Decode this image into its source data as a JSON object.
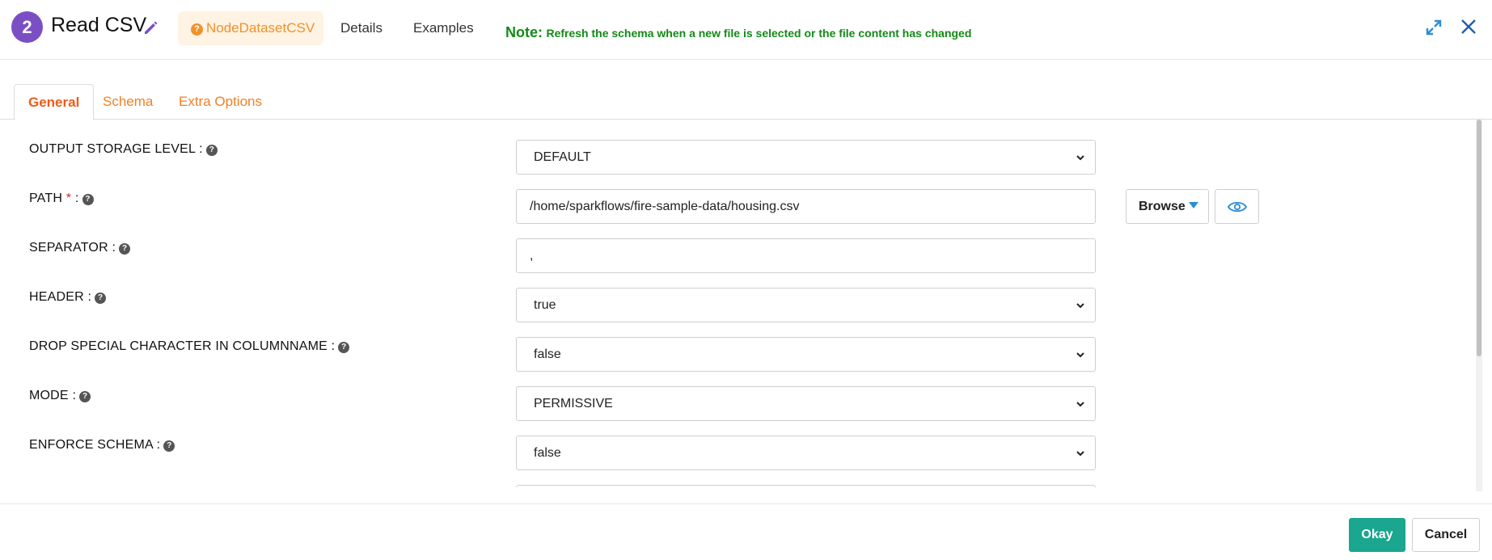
{
  "header": {
    "step_number": "2",
    "title": "Read CSV",
    "node_type": "NodeDatasetCSV",
    "details_link": "Details",
    "examples_link": "Examples",
    "note_label": "Note:",
    "note_text": "Refresh the schema when a new file is selected or the file content has changed"
  },
  "tabs": [
    {
      "label": "General",
      "active": true
    },
    {
      "label": "Schema",
      "active": false
    },
    {
      "label": "Extra Options",
      "active": false
    }
  ],
  "form": {
    "output_storage_level": {
      "label": "OUTPUT STORAGE LEVEL :",
      "value": "DEFAULT"
    },
    "path": {
      "label": "PATH",
      "required_mark": "*",
      "suffix": ":",
      "value": "/home/sparkflows/fire-sample-data/housing.csv"
    },
    "separator": {
      "label": "SEPARATOR :",
      "value": ","
    },
    "header": {
      "label": "HEADER :",
      "value": "true"
    },
    "drop_special": {
      "label": "DROP SPECIAL CHARACTER IN COLUMNNAME :",
      "value": "false"
    },
    "mode": {
      "label": "MODE :",
      "value": "PERMISSIVE"
    },
    "enforce_schema": {
      "label": "ENFORCE SCHEMA :",
      "value": "false"
    }
  },
  "browse_button": "Browse",
  "footer": {
    "okay": "Okay",
    "cancel": "Cancel"
  },
  "colors": {
    "step_badge": "#7b4fc4",
    "node_pill_bg": "#fff3e3",
    "node_pill_text": "#f0922b",
    "note_green": "#138a17",
    "tab_orange": "#f28025",
    "okay_teal": "#1aa68f",
    "icon_blue": "#2a8ed6"
  },
  "icons": [
    "pencil-icon",
    "question-circle-icon",
    "expand-icon",
    "close-icon",
    "chevron-down-icon",
    "eye-icon",
    "caret-down-icon"
  ]
}
